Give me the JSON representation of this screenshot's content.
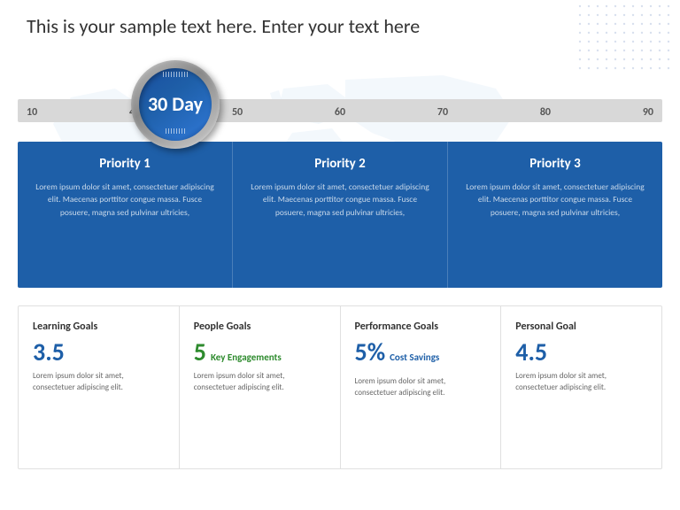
{
  "header": {
    "title": "This is your sample text here. Enter your text here"
  },
  "ruler": {
    "labels": [
      "10",
      "40",
      "50",
      "60",
      "70",
      "80",
      "90"
    ]
  },
  "magnifier": {
    "text": "30 Day"
  },
  "priorities": [
    {
      "title": "Priority 1",
      "body": "Lorem ipsum dolor sit amet, consectetuer adipiscing elit. Maecenas porttitor congue massa. Fusce posuere, magna sed pulvinar ultricies,"
    },
    {
      "title": "Priority 2",
      "body": "Lorem ipsum dolor sit amet, consectetuer adipiscing elit. Maecenas porttitor congue massa. Fusce posuere, magna sed pulvinar ultricies,"
    },
    {
      "title": "Priority 3",
      "body": "Lorem ipsum dolor sit amet, consectetuer adipiscing elit. Maecenas porttitor congue massa. Fusce posuere, magna sed pulvinar ultricies,"
    }
  ],
  "goals": [
    {
      "title": "Learning Goals",
      "number": "3.5",
      "badge": "",
      "badge_type": "plain",
      "body": "Lorem ipsum dolor sit amet, consectetuer adipiscing elit."
    },
    {
      "title": "People Goals",
      "number": "5",
      "badge": "Key Engagements",
      "badge_type": "green",
      "body": "Lorem ipsum dolor sit amet, consectetuer adipiscing elit."
    },
    {
      "title": "Performance Goals",
      "number": "5%",
      "badge": "Cost Savings",
      "badge_type": "blue",
      "body": "Lorem ipsum dolor sit amet, consectetuer adipiscing elit."
    },
    {
      "title": "Personal Goal",
      "number": "4.5",
      "badge": "",
      "badge_type": "plain",
      "body": "Lorem ipsum dolor sit amet, consectetuer adipiscing elit."
    }
  ]
}
